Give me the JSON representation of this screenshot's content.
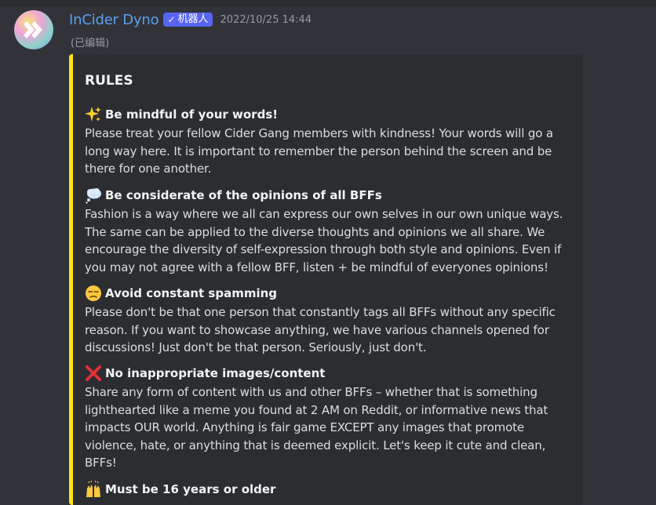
{
  "message": {
    "username": "InCider Dyno",
    "bot_badge": "机器人",
    "bot_check": "✓",
    "timestamp": "2022/10/25 14:44",
    "edited": "(已编辑)"
  },
  "colors": {
    "username": "#5c9ef0",
    "embed_border": "#ffe31a",
    "bot_badge_bg": "#5865f2"
  },
  "embed": {
    "title": "RULES",
    "rules": [
      {
        "icon": "sparkles-icon",
        "title": "Be mindful of your words!",
        "body": "Please treat your fellow Cider Gang members with kindness! Your words will go a long way here. It is important to remember the person behind the screen and be there for one another."
      },
      {
        "icon": "thought-balloon-icon",
        "title": "Be considerate of the opinions of all BFFs",
        "body": "Fashion is a way where we all can express our own selves in our own unique ways. The same can be applied to the diverse thoughts and opinions we all share. We encourage the diversity of self-expression through both style and opinions. Even if you may not agree with a fellow BFF, listen + be mindful of everyones opinions!"
      },
      {
        "icon": "unamused-face-icon",
        "title": "Avoid constant spamming",
        "body": "Please don't be that one person that constantly tags all BFFs without any specific reason. If you want to showcase anything, we have various channels opened for discussions! Just don't be that person. Seriously, just don't."
      },
      {
        "icon": "cross-mark-icon",
        "title": "No inappropriate images/content",
        "body": "Share any form of content with us and other BFFs – whether that is something lighthearted like a meme you found at 2 AM on Reddit, or informative news that impacts OUR world. Anything is fair game EXCEPT any images that promote violence, hate, or anything that is deemed explicit. Let's keep it cute and clean, BFFs!"
      },
      {
        "icon": "raised-hands-icon",
        "title": "Must be 16 years or older",
        "body": ""
      }
    ]
  }
}
